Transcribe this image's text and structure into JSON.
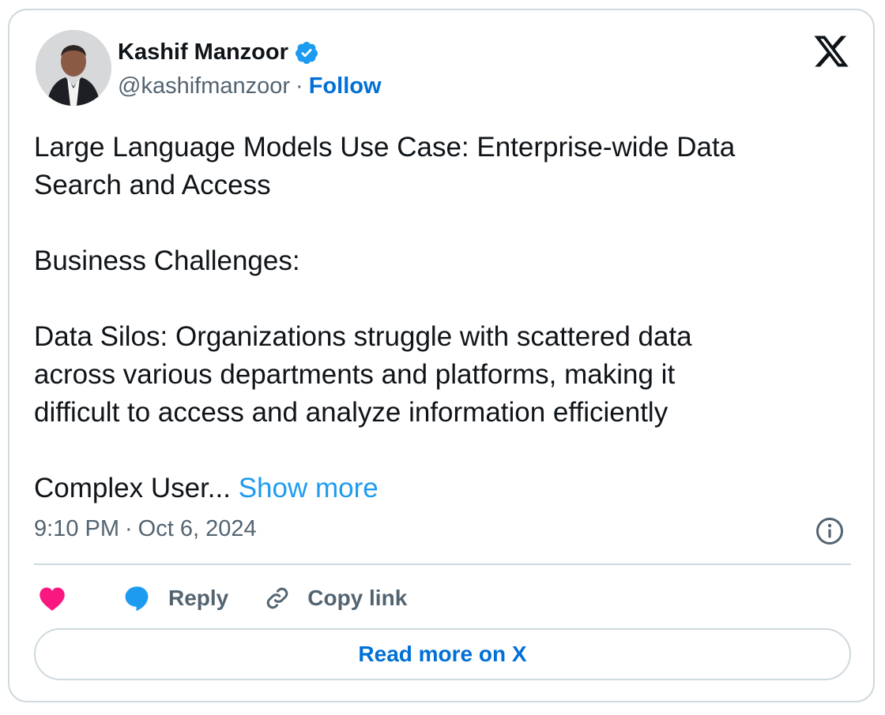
{
  "author": {
    "name": "Kashif Manzoor",
    "handle": "@kashifmanzoor",
    "separator": "·",
    "follow_label": "Follow",
    "verified_icon": "verified-badge-icon"
  },
  "tweet": {
    "lines": [
      "Large Language Models Use Case: Enterprise-wide Data",
      "Search and Access",
      "Business Challenges:",
      "Data Silos: Organizations struggle with scattered data",
      "across various departments and platforms, making it",
      "difficult to access and analyze information efficiently"
    ],
    "truncated_text": "Complex User...",
    "show_more_label": "Show more"
  },
  "meta": {
    "time": "9:10 PM",
    "separator": "·",
    "date": "Oct 6, 2024"
  },
  "actions": {
    "reply_label": "Reply",
    "copy_link_label": "Copy link"
  },
  "read_more_label": "Read more on X",
  "colors": {
    "link_blue": "#006fd6",
    "show_more_blue": "#1d9bf0",
    "like_pink": "#f91880",
    "reply_blue": "#1d9bf0",
    "secondary_text": "#536471",
    "border": "#cfd9de"
  }
}
